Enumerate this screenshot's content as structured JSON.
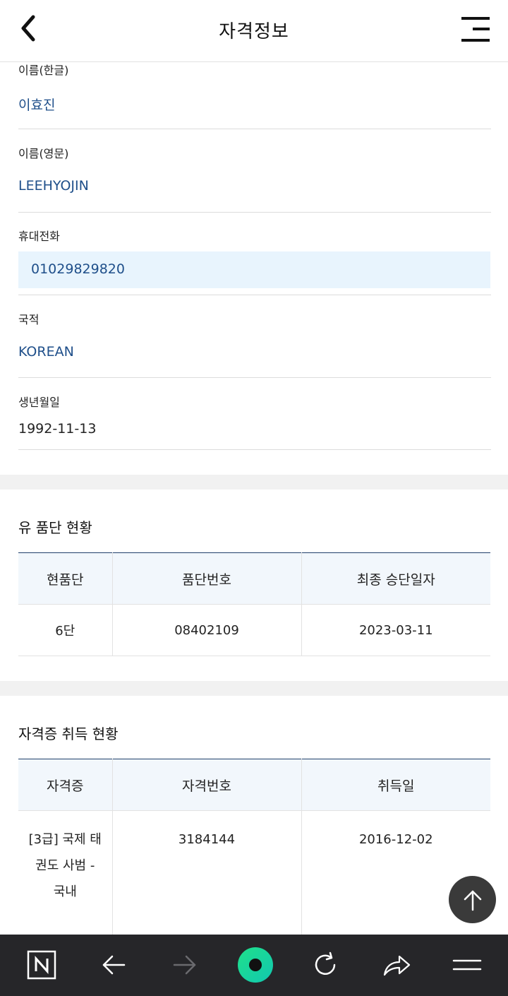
{
  "header": {
    "title": "자격정보"
  },
  "profile": {
    "name_kr_label": "이름(한글)",
    "name_kr_value": "이효진",
    "name_en_label": "이름(영문)",
    "name_en_value": "LEEHYOJIN",
    "phone_label": "휴대전화",
    "phone_value": "01029829820",
    "nationality_label": "국적",
    "nationality_value": "KOREAN",
    "birth_label": "생년월일",
    "birth_value": "1992-11-13"
  },
  "poom_section": {
    "title": "유 품단 현황",
    "headers": [
      "현품단",
      "품단번호",
      "최종 승단일자"
    ],
    "rows": [
      [
        "6단",
        "08402109",
        "2023-03-11"
      ]
    ]
  },
  "license_section": {
    "title": "자격증 취득 현황",
    "headers": [
      "자격증",
      "자격번호",
      "취득일"
    ],
    "rows": [
      [
        "[3급] 국제 태권도 사범 - 국내",
        "3184144",
        "2016-12-02"
      ]
    ]
  },
  "colors": {
    "value_blue": "#1f4f8a",
    "phone_highlight": "#e8f4fd",
    "bottom_bar": "#262629",
    "accent_green": "#1fe08a"
  },
  "icons": {
    "back": "chevron-left-icon",
    "menu": "hamburger-icon",
    "scroll_top": "arrow-up-icon",
    "nav": [
      "naver-n-icon",
      "arrow-left-icon",
      "arrow-right-icon",
      "green-dot-icon",
      "refresh-icon",
      "share-icon",
      "menu-lines-icon"
    ]
  }
}
